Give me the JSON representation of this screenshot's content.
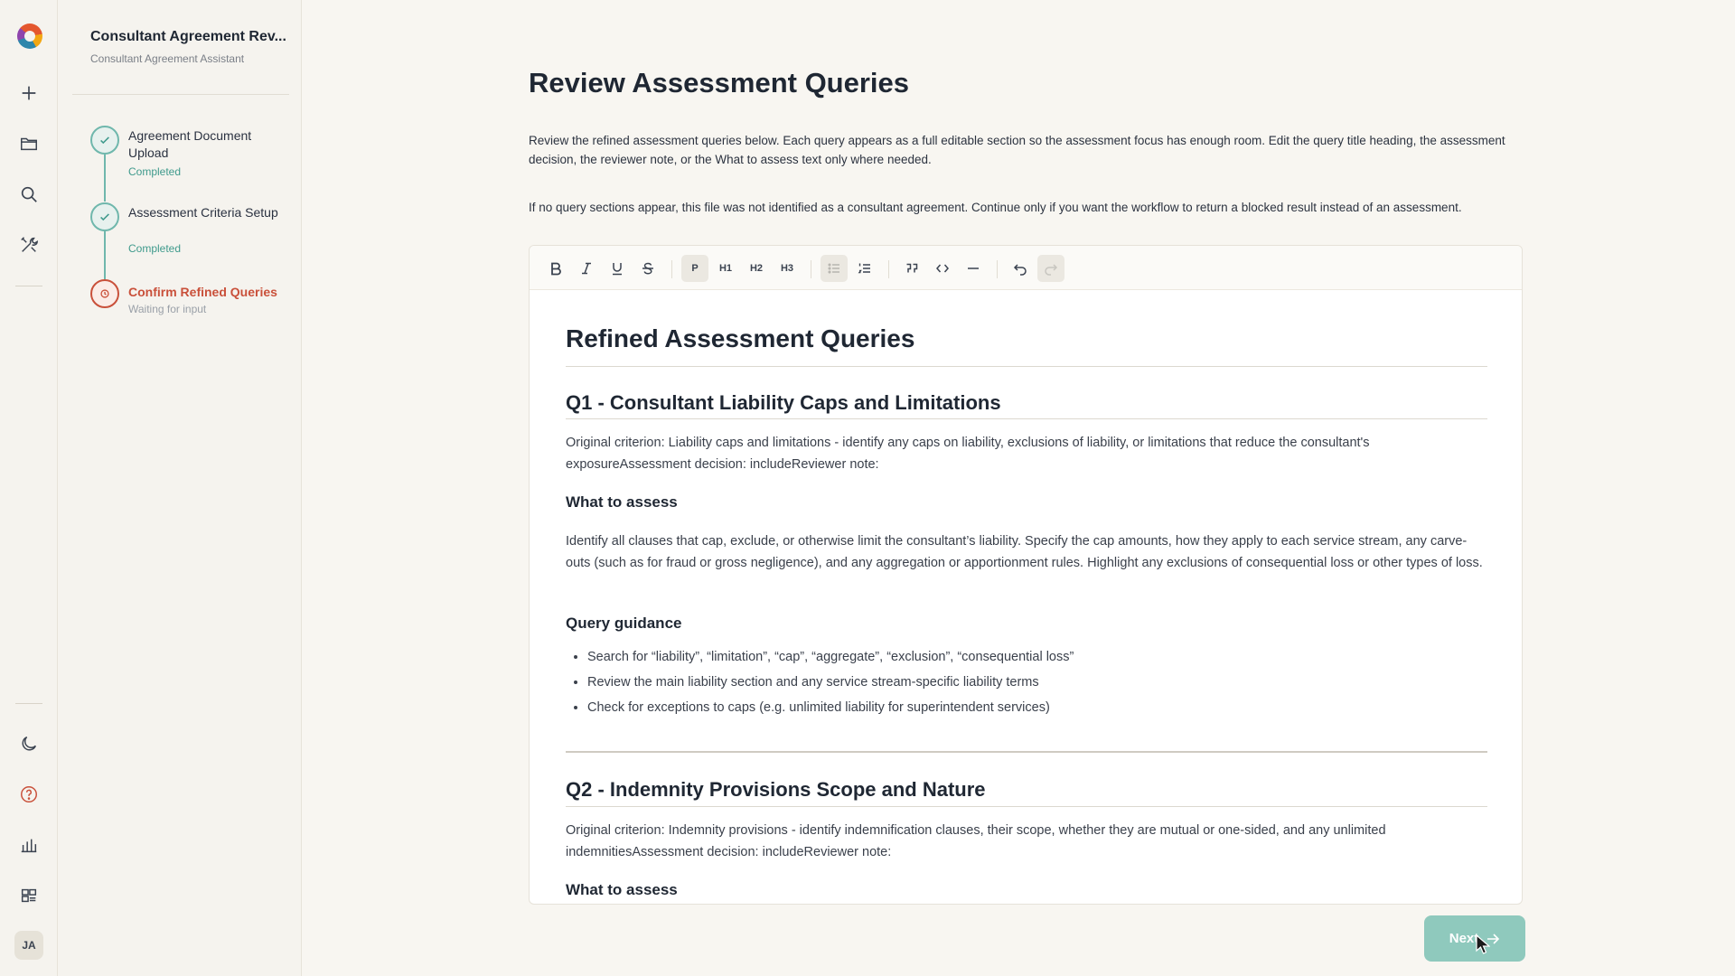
{
  "app": {
    "user_initials": "JA"
  },
  "sidebar": {
    "title": "Consultant Agreement Rev...",
    "subtitle": "Consultant Agreement Assistant",
    "steps": [
      {
        "label": "Agreement Document Upload",
        "status": "Completed"
      },
      {
        "label": "Assessment Criteria Setup",
        "status": "Completed"
      },
      {
        "label": "Confirm Refined Queries",
        "status": "Waiting for input"
      }
    ]
  },
  "main": {
    "title": "Review Assessment Queries",
    "description_1": "Review the refined assessment queries below. Each query appears as a full editable section so the assessment focus has enough room. Edit the query title heading, the assessment decision, the reviewer note, or the What to assess text only where needed.",
    "description_2": "If no query sections appear, this file was not identified as a consultant agreement. Continue only if you want the workflow to return a blocked result instead of an assessment.",
    "next_label": "Next"
  },
  "toolbar": {
    "paragraph": "P",
    "h1": "H1",
    "h2": "H2",
    "h3": "H3"
  },
  "document": {
    "heading": "Refined Assessment Queries",
    "q1": {
      "title": "Q1 - Consultant Liability Caps and Limitations",
      "original": "Original criterion: Liability caps and limitations - identify any caps on liability, exclusions of liability, or limitations that reduce the consultant's exposureAssessment decision: includeReviewer note:",
      "what_heading": "What to assess",
      "what_text": "Identify all clauses that cap, exclude, or otherwise limit the consultant’s liability. Specify the cap amounts, how they apply to each service stream, any carve-outs (such as for fraud or gross negligence), and any aggregation or apportionment rules. Highlight any exclusions of consequential loss or other types of loss.",
      "guidance_heading": "Query guidance",
      "guidance": [
        "Search for “liability”, “limitation”, “cap”, “aggregate”, “exclusion”, “consequential loss”",
        "Review the main liability section and any service stream-specific liability terms",
        "Check for exceptions to caps (e.g. unlimited liability for superintendent services)"
      ]
    },
    "q2": {
      "title": "Q2 - Indemnity Provisions Scope and Nature",
      "original": "Original criterion: Indemnity provisions - identify indemnification clauses, their scope, whether they are mutual or one-sided, and any unlimited indemnitiesAssessment decision: includeReviewer note:",
      "what_heading": "What to assess"
    }
  }
}
